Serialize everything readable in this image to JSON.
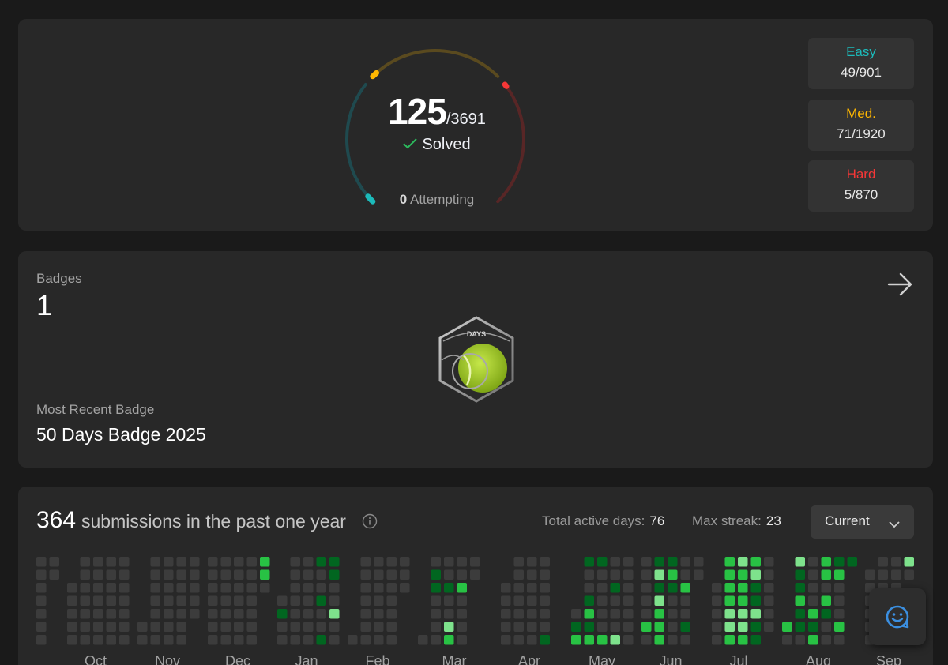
{
  "progress": {
    "solved": "125",
    "total": "/3691",
    "solved_label": "Solved",
    "attempting_count": "0",
    "attempting_label": " Attempting",
    "ring_colors": {
      "easy": "#1cbaba",
      "medium": "#ffb700",
      "hard": "#f63737"
    },
    "fractions": {
      "easy": 0.0544,
      "medium": 0.037,
      "hard": 0.0057
    }
  },
  "difficulties": [
    {
      "label": "Easy",
      "value": "49/901",
      "color": "#1cbaba"
    },
    {
      "label": "Med.",
      "value": "71/1920",
      "color": "#ffb700"
    },
    {
      "label": "Hard",
      "value": "5/870",
      "color": "#f63737"
    }
  ],
  "badges": {
    "title": "Badges",
    "count": "1",
    "badge_text": "DAYS",
    "recent_title": "Most Recent Badge",
    "recent_name": "50 Days Badge 2025"
  },
  "calendar": {
    "submissions": "364",
    "submissions_text": "submissions in the past one year",
    "active_days_label": "Total active days:",
    "active_days": "76",
    "max_streak_label": "Max streak:",
    "max_streak": "23",
    "range_select": "Current",
    "months": [
      "Oct",
      "Nov",
      "Dec",
      "Jan",
      "Feb",
      "Mar",
      "Apr",
      "May",
      "Jun",
      "Jul",
      "Aug",
      "Sep"
    ],
    "colors": {
      "empty": "#3c3c3c",
      "l1": "#016620",
      "l2": "#28c244",
      "l3": "#7ee28c"
    }
  }
}
